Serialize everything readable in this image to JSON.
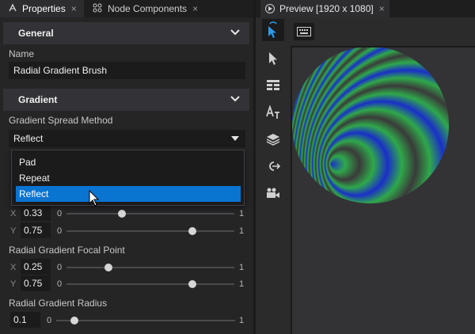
{
  "tabs": {
    "properties": "Properties",
    "node_components": "Node Components",
    "close_glyph": "×"
  },
  "general": {
    "header": "General",
    "name_label": "Name",
    "name_value": "Radial Gradient Brush"
  },
  "gradient": {
    "header": "Gradient",
    "spread_label": "Gradient Spread Method",
    "spread_value": "Reflect",
    "spread_options": [
      "Pad",
      "Repeat",
      "Reflect"
    ],
    "spread_selected_index": 2,
    "center_x": {
      "axis": "X",
      "value": "0.33",
      "min": "0",
      "max": "1",
      "fraction": 0.33
    },
    "center_y": {
      "axis": "Y",
      "value": "0.75",
      "min": "0",
      "max": "1",
      "fraction": 0.75
    },
    "focal_label": "Radial Gradient Focal Point",
    "focal_x": {
      "axis": "X",
      "value": "0.25",
      "min": "0",
      "max": "1",
      "fraction": 0.25
    },
    "focal_y": {
      "axis": "Y",
      "value": "0.75",
      "min": "0",
      "max": "1",
      "fraction": 0.75
    },
    "radius_label": "Radial Gradient Radius",
    "radius": {
      "value": "0.1",
      "min": "0",
      "max": "1",
      "fraction": 0.1
    }
  },
  "preview": {
    "tab_title": "Preview [1920 x 1080]",
    "gradient_colors": [
      "#1a2fc8",
      "#2fa84a",
      "#3a3a3a"
    ]
  },
  "icons": {
    "tools": [
      "select-touch-icon",
      "pointer-icon",
      "grid-icon",
      "text-icon",
      "layers-icon",
      "connect-icon",
      "camera-icon"
    ],
    "keyboard": "keyboard-icon"
  },
  "colors": {
    "accent": "#0a74d1",
    "panel": "#252526",
    "field": "#1b1b1c"
  }
}
